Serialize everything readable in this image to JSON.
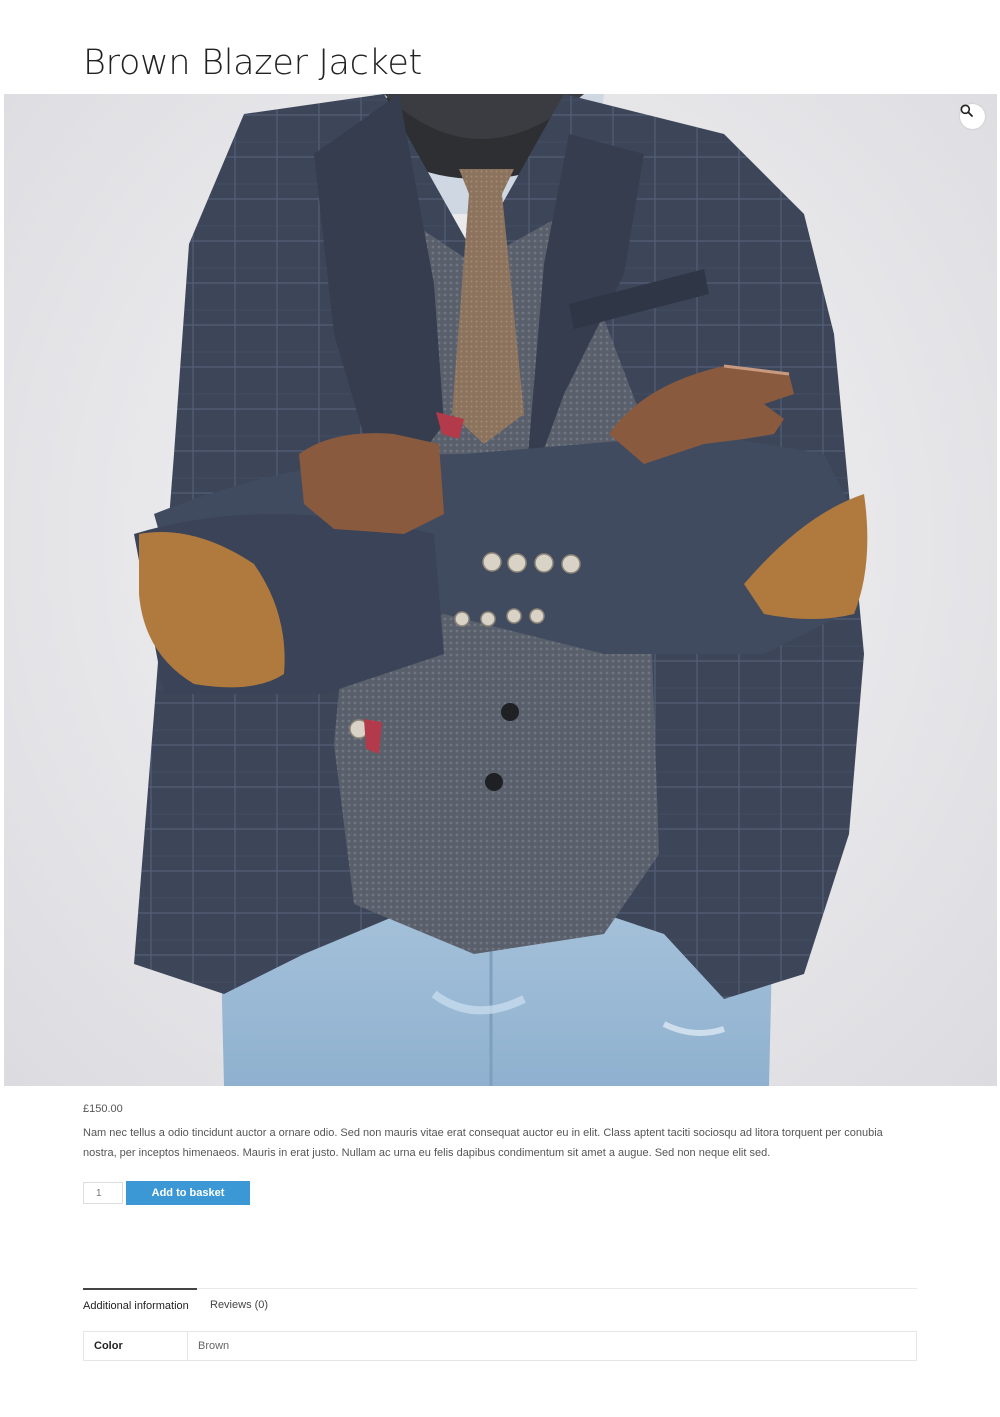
{
  "product": {
    "title": "Brown Blazer Jacket",
    "price": "£150.00",
    "description": "Nam nec tellus a odio tincidunt auctor a ornare odio. Sed non mauris vitae erat consequat auctor eu in elit. Class aptent taciti sociosqu ad litora torquent per conubia nostra, per inceptos himenaeos. Mauris in erat justo. Nullam ac urna eu felis dapibus condimentum sit amet a augue. Sed non neque elit sed."
  },
  "gallery": {
    "zoom_icon": "search-icon"
  },
  "cart": {
    "quantity": "1",
    "add_label": "Add to basket",
    "button_color": "#3b98d4"
  },
  "tabs": [
    {
      "label": "Additional information",
      "active": true
    },
    {
      "label": "Reviews (0)",
      "active": false
    }
  ],
  "attributes": [
    {
      "name": "Color",
      "value": "Brown"
    }
  ]
}
